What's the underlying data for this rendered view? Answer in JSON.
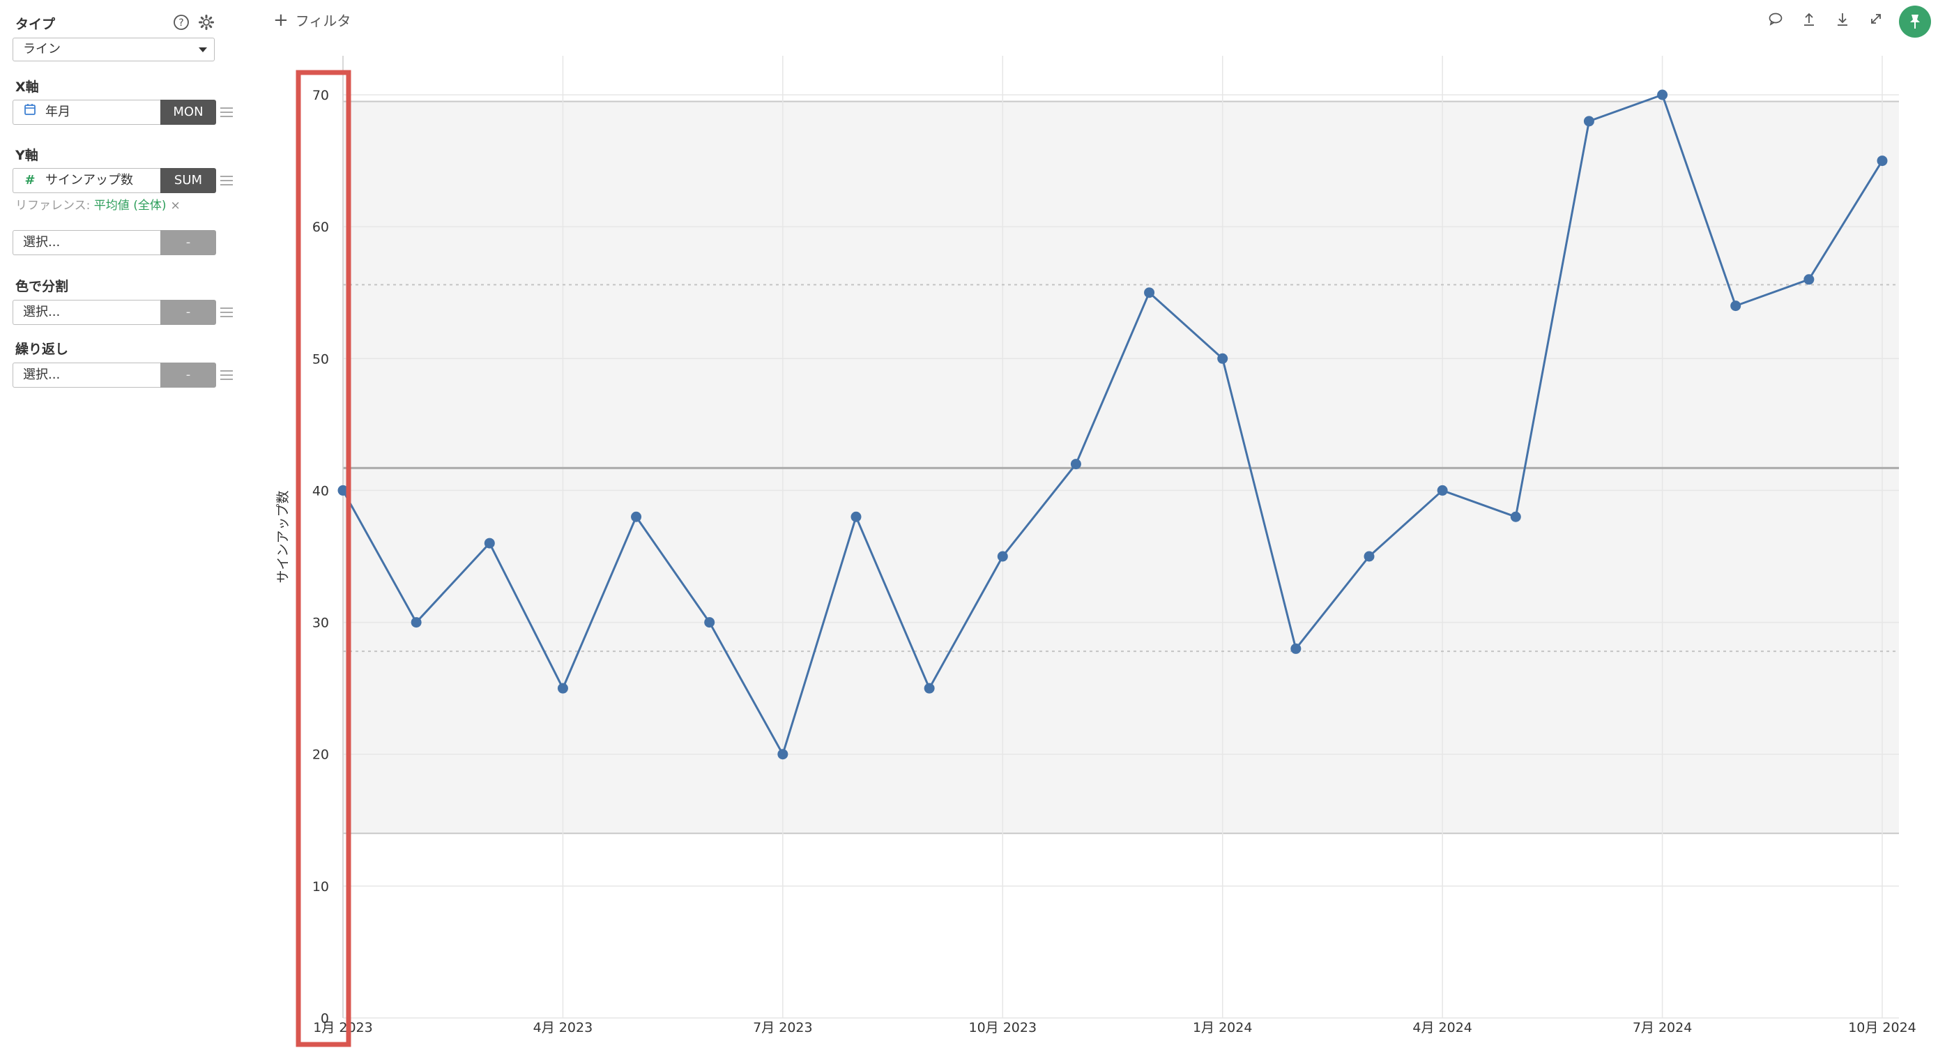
{
  "sidebar": {
    "type_label": "タイプ",
    "type_value": "ライン",
    "x_label": "X軸",
    "x_field": "年月",
    "x_agg": "MON",
    "y_label": "Y軸",
    "y_field": "サインアップ数",
    "y_agg": "SUM",
    "reference_prefix": "リファレンス: ",
    "reference_value": "平均値 (全体)",
    "reference_remove": "×",
    "extra_placeholder": "選択...",
    "extra_agg": "-",
    "color_label": "色で分割",
    "color_placeholder": "選択...",
    "color_agg": "-",
    "repeat_label": "繰り返し",
    "repeat_placeholder": "選択...",
    "repeat_agg": "-"
  },
  "toolbar": {
    "filter_icon": "plus-icon",
    "filter_label": "フィルタ",
    "icons": [
      "comment-icon",
      "upload-icon",
      "download-icon",
      "expand-icon",
      "pin-icon"
    ]
  },
  "colors": {
    "line": "#4472a8",
    "band": "#f4f4f4",
    "pin": "#3aa36b",
    "highlight": "#d9564f",
    "accent_green": "#2e9e5b"
  },
  "chart_data": {
    "type": "line",
    "ylabel": "サインアップ数",
    "xlabel": "",
    "ylim": [
      0,
      70
    ],
    "yticks": [
      0,
      10,
      20,
      30,
      40,
      50,
      60,
      70
    ],
    "x": [
      "2023-01",
      "2023-02",
      "2023-03",
      "2023-04",
      "2023-05",
      "2023-06",
      "2023-07",
      "2023-08",
      "2023-09",
      "2023-10",
      "2023-11",
      "2023-12",
      "2024-01",
      "2024-02",
      "2024-03",
      "2024-04",
      "2024-05",
      "2024-06",
      "2024-07",
      "2024-08",
      "2024-09",
      "2024-10"
    ],
    "xtick_labels": [
      "1月 2023",
      "4月 2023",
      "7月 2023",
      "10月 2023",
      "1月 2024",
      "4月 2024",
      "7月 2024",
      "10月 2024"
    ],
    "xtick_months": [
      "2023-01",
      "2023-04",
      "2023-07",
      "2023-10",
      "2024-01",
      "2024-04",
      "2024-07",
      "2024-10"
    ],
    "series": [
      {
        "values": [
          40,
          30,
          36,
          25,
          38,
          30,
          20,
          38,
          25,
          35,
          42,
          55,
          50,
          28,
          35,
          40,
          38,
          68,
          70,
          54,
          56,
          65
        ]
      }
    ],
    "reference": {
      "average": 41.7,
      "band": [
        14,
        69.5
      ],
      "dotted": [
        27.8,
        55.6
      ]
    },
    "grid": true
  }
}
